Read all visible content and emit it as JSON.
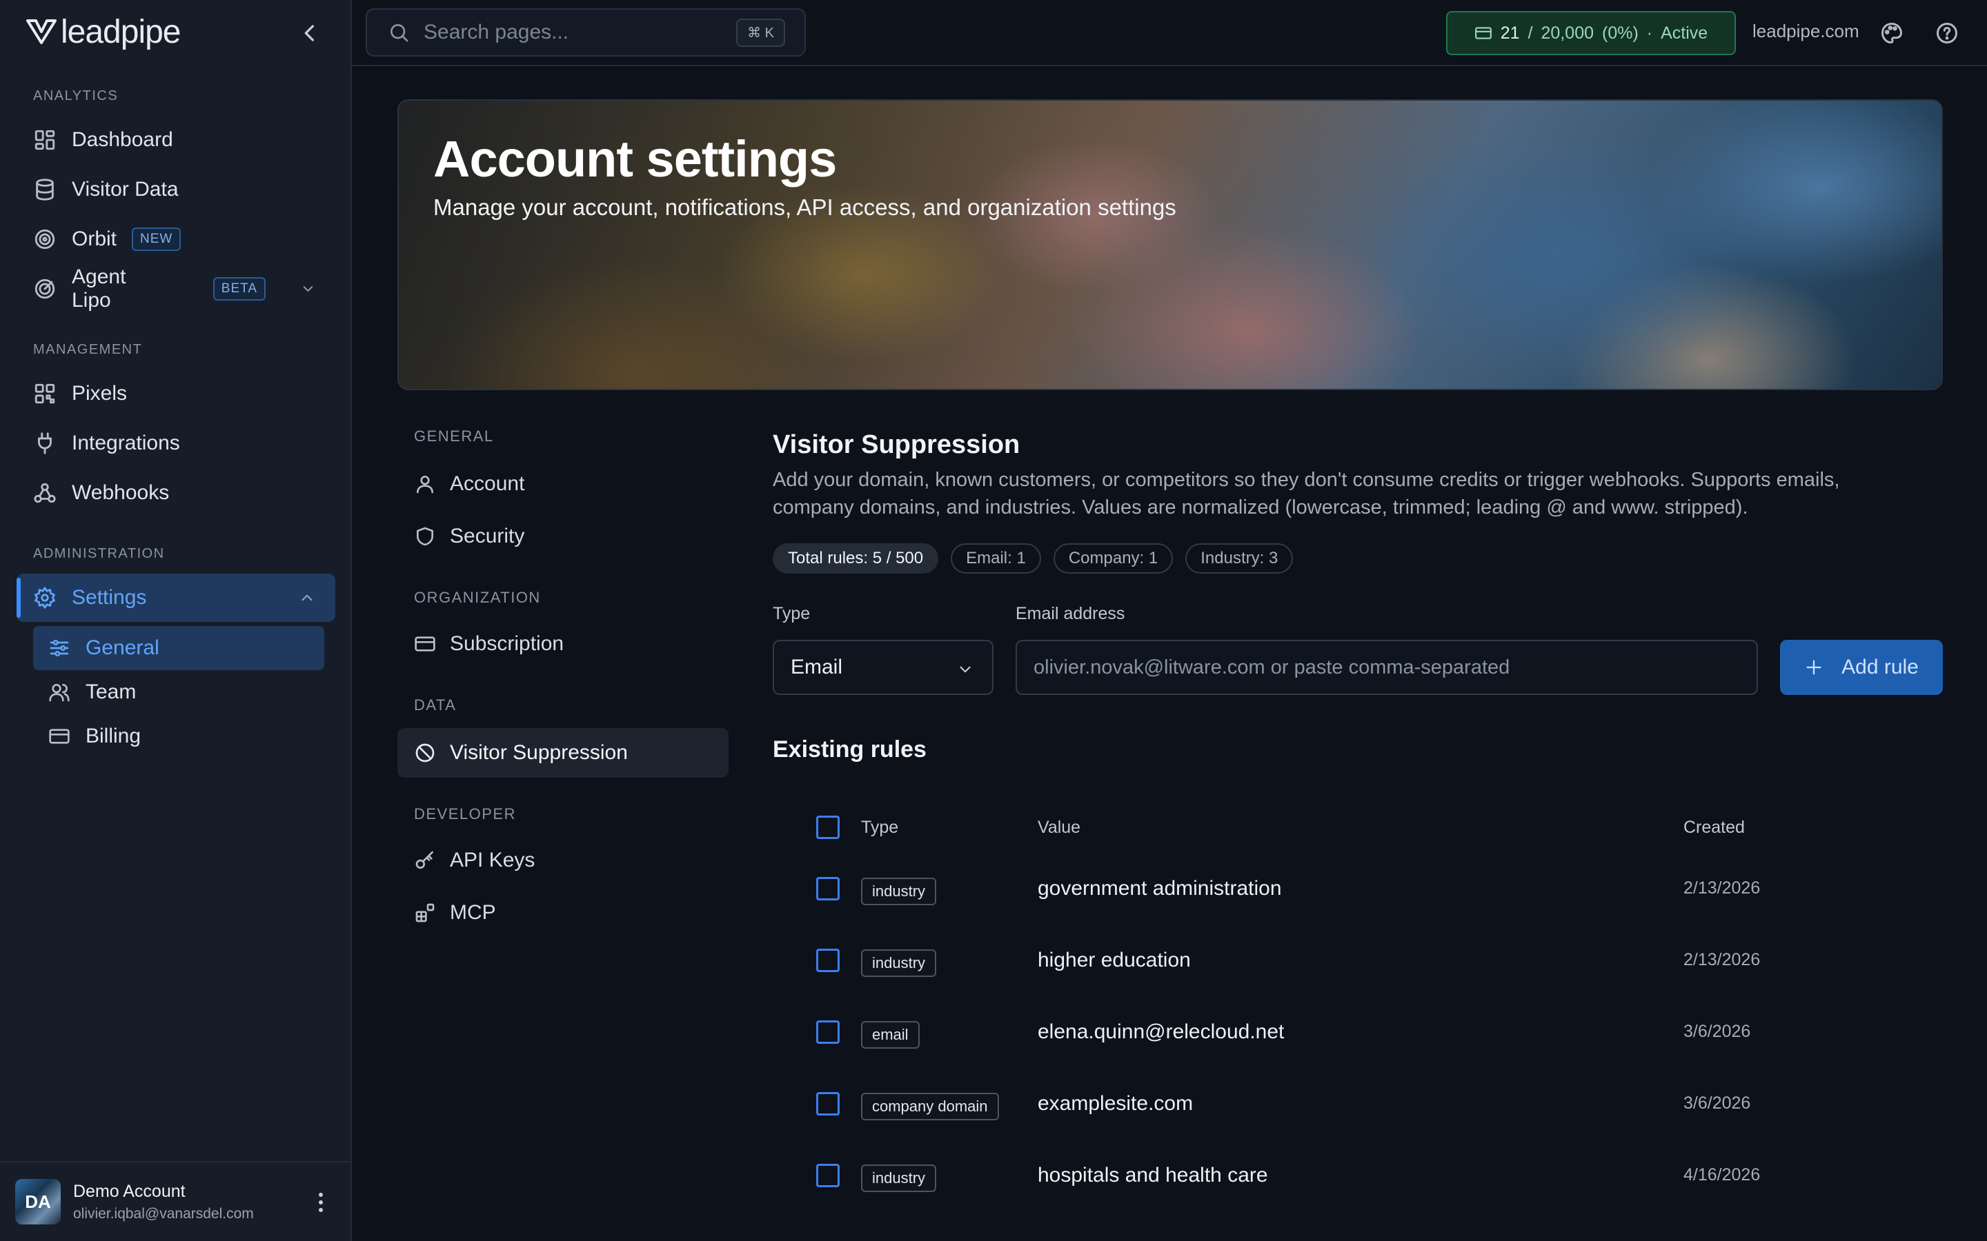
{
  "brand": {
    "name": "leadpipe"
  },
  "sidebar": {
    "sections": {
      "analytics": "ANALYTICS",
      "management": "MANAGEMENT",
      "administration": "ADMINISTRATION"
    },
    "items": {
      "dashboard": "Dashboard",
      "visitor_data": "Visitor Data",
      "orbit": "Orbit",
      "orbit_badge": "NEW",
      "agent_lipo": "Agent Lipo",
      "agent_lipo_badge": "BETA",
      "pixels": "Pixels",
      "integrations": "Integrations",
      "webhooks": "Webhooks",
      "settings": "Settings"
    },
    "settings_sub": {
      "general": "General",
      "team": "Team",
      "billing": "Billing"
    },
    "user": {
      "initials": "DA",
      "name": "Demo Account",
      "email": "olivier.iqbal@vanarsdel.com"
    }
  },
  "topbar": {
    "search_placeholder": "Search pages...",
    "shortcut": "⌘ K",
    "credits": {
      "used": "21",
      "separator": "/",
      "total": "20,000",
      "percent": "(0%)",
      "dot": "·",
      "status": "Active"
    },
    "domain": "leadpipe.com"
  },
  "hero": {
    "title": "Account settings",
    "subtitle": "Manage your account, notifications, API access, and organization settings"
  },
  "settings_nav": {
    "general_label": "GENERAL",
    "account": "Account",
    "security": "Security",
    "organization_label": "ORGANIZATION",
    "subscription": "Subscription",
    "data_label": "DATA",
    "visitor_suppression": "Visitor Suppression",
    "developer_label": "DEVELOPER",
    "api_keys": "API Keys",
    "mcp": "MCP"
  },
  "main": {
    "title": "Visitor Suppression",
    "description": "Add your domain, known customers, or competitors so they don't consume credits or trigger webhooks. Supports emails, company domains, and industries. Values are normalized (lowercase, trimmed; leading @ and www. stripped).",
    "chips": {
      "total": "Total rules: 5 / 500",
      "email": "Email: 1",
      "company": "Company: 1",
      "industry": "Industry: 3"
    },
    "form": {
      "type_label": "Type",
      "type_value": "Email",
      "email_label": "Email address",
      "email_placeholder": "olivier.novak@litware.com or paste comma-separated",
      "add_button": "Add rule"
    },
    "existing_title": "Existing rules",
    "table": {
      "headers": {
        "type": "Type",
        "value": "Value",
        "created": "Created"
      },
      "rows": [
        {
          "type": "industry",
          "value": "government administration",
          "created": "2/13/2026"
        },
        {
          "type": "industry",
          "value": "higher education",
          "created": "2/13/2026"
        },
        {
          "type": "email",
          "value": "elena.quinn@relecloud.net",
          "created": "3/6/2026"
        },
        {
          "type": "company domain",
          "value": "examplesite.com",
          "created": "3/6/2026"
        },
        {
          "type": "industry",
          "value": "hospitals and health care",
          "created": "4/16/2026"
        }
      ]
    }
  },
  "colors": {
    "accent": "#3c8dff",
    "active_bg": "#1f3a5e",
    "credits_bg": "#133326",
    "credits_border": "#1f7a4e",
    "add_button": "#1f5fb0"
  }
}
